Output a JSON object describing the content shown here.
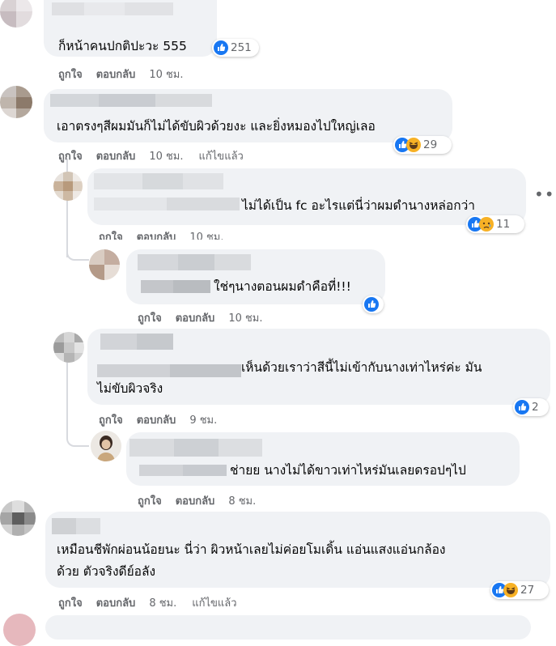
{
  "comments": [
    {
      "text": [
        "ก็หน้าคนปกติปะวะ 555"
      ],
      "like": "ถูกใจ",
      "reply": "ตอบกลับ",
      "time": "10 ชม.",
      "reactions": [
        "like"
      ],
      "count": "251"
    },
    {
      "text": [
        "เอาตรงๆสีผมมันก็ไม่ได้ขับผิวด้วยงะ และยิ่งหมองไปใหญ่เลอ"
      ],
      "like": "ถูกใจ",
      "reply": "ตอบกลับ",
      "time": "10 ชม.",
      "edited": "แก้ไขแล้ว",
      "reactions": [
        "like",
        "haha"
      ],
      "count": "29"
    },
    {
      "text": [
        "ไม่ได้เป็น fc อะไรแต่นี่ว่าผมดำนางหล่อกว่า"
      ],
      "like": "ถูกใจ",
      "reply": "ตอบกลับ",
      "time": "10 ชม.",
      "reactions": [
        "like",
        "sad"
      ],
      "count": "11"
    },
    {
      "text": [
        "ใช่ๆนางตอนผมดำคือที่!!!"
      ],
      "like": "ถูกใจ",
      "reply": "ตอบกลับ",
      "time": "10 ชม.",
      "reactions": [
        "like"
      ],
      "count": ""
    },
    {
      "text": [
        "เห็นด้วยเราว่าสีนี้ไม่เข้ากับนางเท่าไหร่ค่ะ มัน",
        "ไม่ขับผิวจริง"
      ],
      "like": "ถูกใจ",
      "reply": "ตอบกลับ",
      "time": "9 ชม.",
      "reactions": [
        "like"
      ],
      "count": "2"
    },
    {
      "text": [
        "ช่ายย นางไม่ได้ขาวเท่าไหร่มันเลยดรอปๆไป"
      ],
      "like": "ถูกใจ",
      "reply": "ตอบกลับ",
      "time": "8 ชม.",
      "reactions": [],
      "count": ""
    },
    {
      "text": [
        "เหมือนชีพักผ่อนน้อยนะ นี่ว่า ผิวหน้าเลยไม่ค่อยโมเดิ้น แอ่นแสงแอ่นกล้อง",
        "ด้วย ตัวจริงดีย์อลัง"
      ],
      "like": "ถูกใจ",
      "reply": "ตอบกลับ",
      "time": "8 ชม.",
      "edited": "แก้ไขแล้ว",
      "reactions": [
        "like",
        "haha"
      ],
      "count": "27"
    }
  ],
  "more_icon": "more-horizontal-icon",
  "colors": {
    "like_blue": "#1877f2",
    "haha_yellow": "#f7b125",
    "bubble": "#f0f2f5",
    "meta": "#65676b"
  }
}
